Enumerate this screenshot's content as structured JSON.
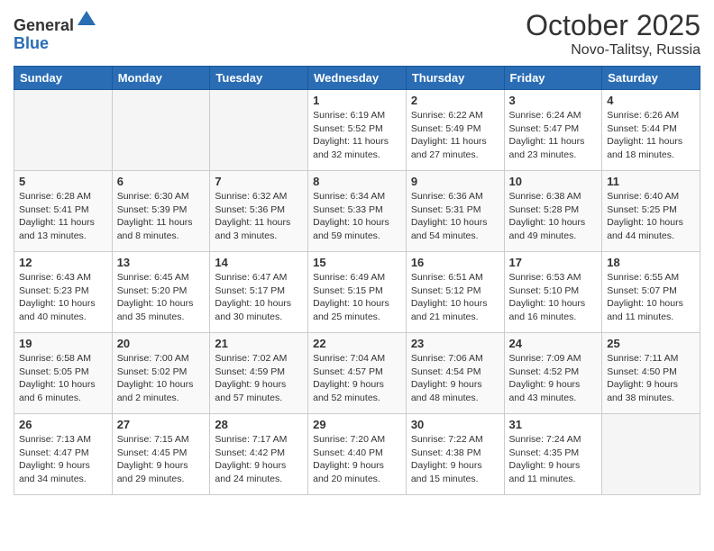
{
  "header": {
    "logo_line1": "General",
    "logo_line2": "Blue",
    "month": "October 2025",
    "location": "Novo-Talitsy, Russia"
  },
  "weekdays": [
    "Sunday",
    "Monday",
    "Tuesday",
    "Wednesday",
    "Thursday",
    "Friday",
    "Saturday"
  ],
  "weeks": [
    [
      {
        "day": "",
        "info": ""
      },
      {
        "day": "",
        "info": ""
      },
      {
        "day": "",
        "info": ""
      },
      {
        "day": "1",
        "info": "Sunrise: 6:19 AM\nSunset: 5:52 PM\nDaylight: 11 hours\nand 32 minutes."
      },
      {
        "day": "2",
        "info": "Sunrise: 6:22 AM\nSunset: 5:49 PM\nDaylight: 11 hours\nand 27 minutes."
      },
      {
        "day": "3",
        "info": "Sunrise: 6:24 AM\nSunset: 5:47 PM\nDaylight: 11 hours\nand 23 minutes."
      },
      {
        "day": "4",
        "info": "Sunrise: 6:26 AM\nSunset: 5:44 PM\nDaylight: 11 hours\nand 18 minutes."
      }
    ],
    [
      {
        "day": "5",
        "info": "Sunrise: 6:28 AM\nSunset: 5:41 PM\nDaylight: 11 hours\nand 13 minutes."
      },
      {
        "day": "6",
        "info": "Sunrise: 6:30 AM\nSunset: 5:39 PM\nDaylight: 11 hours\nand 8 minutes."
      },
      {
        "day": "7",
        "info": "Sunrise: 6:32 AM\nSunset: 5:36 PM\nDaylight: 11 hours\nand 3 minutes."
      },
      {
        "day": "8",
        "info": "Sunrise: 6:34 AM\nSunset: 5:33 PM\nDaylight: 10 hours\nand 59 minutes."
      },
      {
        "day": "9",
        "info": "Sunrise: 6:36 AM\nSunset: 5:31 PM\nDaylight: 10 hours\nand 54 minutes."
      },
      {
        "day": "10",
        "info": "Sunrise: 6:38 AM\nSunset: 5:28 PM\nDaylight: 10 hours\nand 49 minutes."
      },
      {
        "day": "11",
        "info": "Sunrise: 6:40 AM\nSunset: 5:25 PM\nDaylight: 10 hours\nand 44 minutes."
      }
    ],
    [
      {
        "day": "12",
        "info": "Sunrise: 6:43 AM\nSunset: 5:23 PM\nDaylight: 10 hours\nand 40 minutes."
      },
      {
        "day": "13",
        "info": "Sunrise: 6:45 AM\nSunset: 5:20 PM\nDaylight: 10 hours\nand 35 minutes."
      },
      {
        "day": "14",
        "info": "Sunrise: 6:47 AM\nSunset: 5:17 PM\nDaylight: 10 hours\nand 30 minutes."
      },
      {
        "day": "15",
        "info": "Sunrise: 6:49 AM\nSunset: 5:15 PM\nDaylight: 10 hours\nand 25 minutes."
      },
      {
        "day": "16",
        "info": "Sunrise: 6:51 AM\nSunset: 5:12 PM\nDaylight: 10 hours\nand 21 minutes."
      },
      {
        "day": "17",
        "info": "Sunrise: 6:53 AM\nSunset: 5:10 PM\nDaylight: 10 hours\nand 16 minutes."
      },
      {
        "day": "18",
        "info": "Sunrise: 6:55 AM\nSunset: 5:07 PM\nDaylight: 10 hours\nand 11 minutes."
      }
    ],
    [
      {
        "day": "19",
        "info": "Sunrise: 6:58 AM\nSunset: 5:05 PM\nDaylight: 10 hours\nand 6 minutes."
      },
      {
        "day": "20",
        "info": "Sunrise: 7:00 AM\nSunset: 5:02 PM\nDaylight: 10 hours\nand 2 minutes."
      },
      {
        "day": "21",
        "info": "Sunrise: 7:02 AM\nSunset: 4:59 PM\nDaylight: 9 hours\nand 57 minutes."
      },
      {
        "day": "22",
        "info": "Sunrise: 7:04 AM\nSunset: 4:57 PM\nDaylight: 9 hours\nand 52 minutes."
      },
      {
        "day": "23",
        "info": "Sunrise: 7:06 AM\nSunset: 4:54 PM\nDaylight: 9 hours\nand 48 minutes."
      },
      {
        "day": "24",
        "info": "Sunrise: 7:09 AM\nSunset: 4:52 PM\nDaylight: 9 hours\nand 43 minutes."
      },
      {
        "day": "25",
        "info": "Sunrise: 7:11 AM\nSunset: 4:50 PM\nDaylight: 9 hours\nand 38 minutes."
      }
    ],
    [
      {
        "day": "26",
        "info": "Sunrise: 7:13 AM\nSunset: 4:47 PM\nDaylight: 9 hours\nand 34 minutes."
      },
      {
        "day": "27",
        "info": "Sunrise: 7:15 AM\nSunset: 4:45 PM\nDaylight: 9 hours\nand 29 minutes."
      },
      {
        "day": "28",
        "info": "Sunrise: 7:17 AM\nSunset: 4:42 PM\nDaylight: 9 hours\nand 24 minutes."
      },
      {
        "day": "29",
        "info": "Sunrise: 7:20 AM\nSunset: 4:40 PM\nDaylight: 9 hours\nand 20 minutes."
      },
      {
        "day": "30",
        "info": "Sunrise: 7:22 AM\nSunset: 4:38 PM\nDaylight: 9 hours\nand 15 minutes."
      },
      {
        "day": "31",
        "info": "Sunrise: 7:24 AM\nSunset: 4:35 PM\nDaylight: 9 hours\nand 11 minutes."
      },
      {
        "day": "",
        "info": ""
      }
    ]
  ]
}
